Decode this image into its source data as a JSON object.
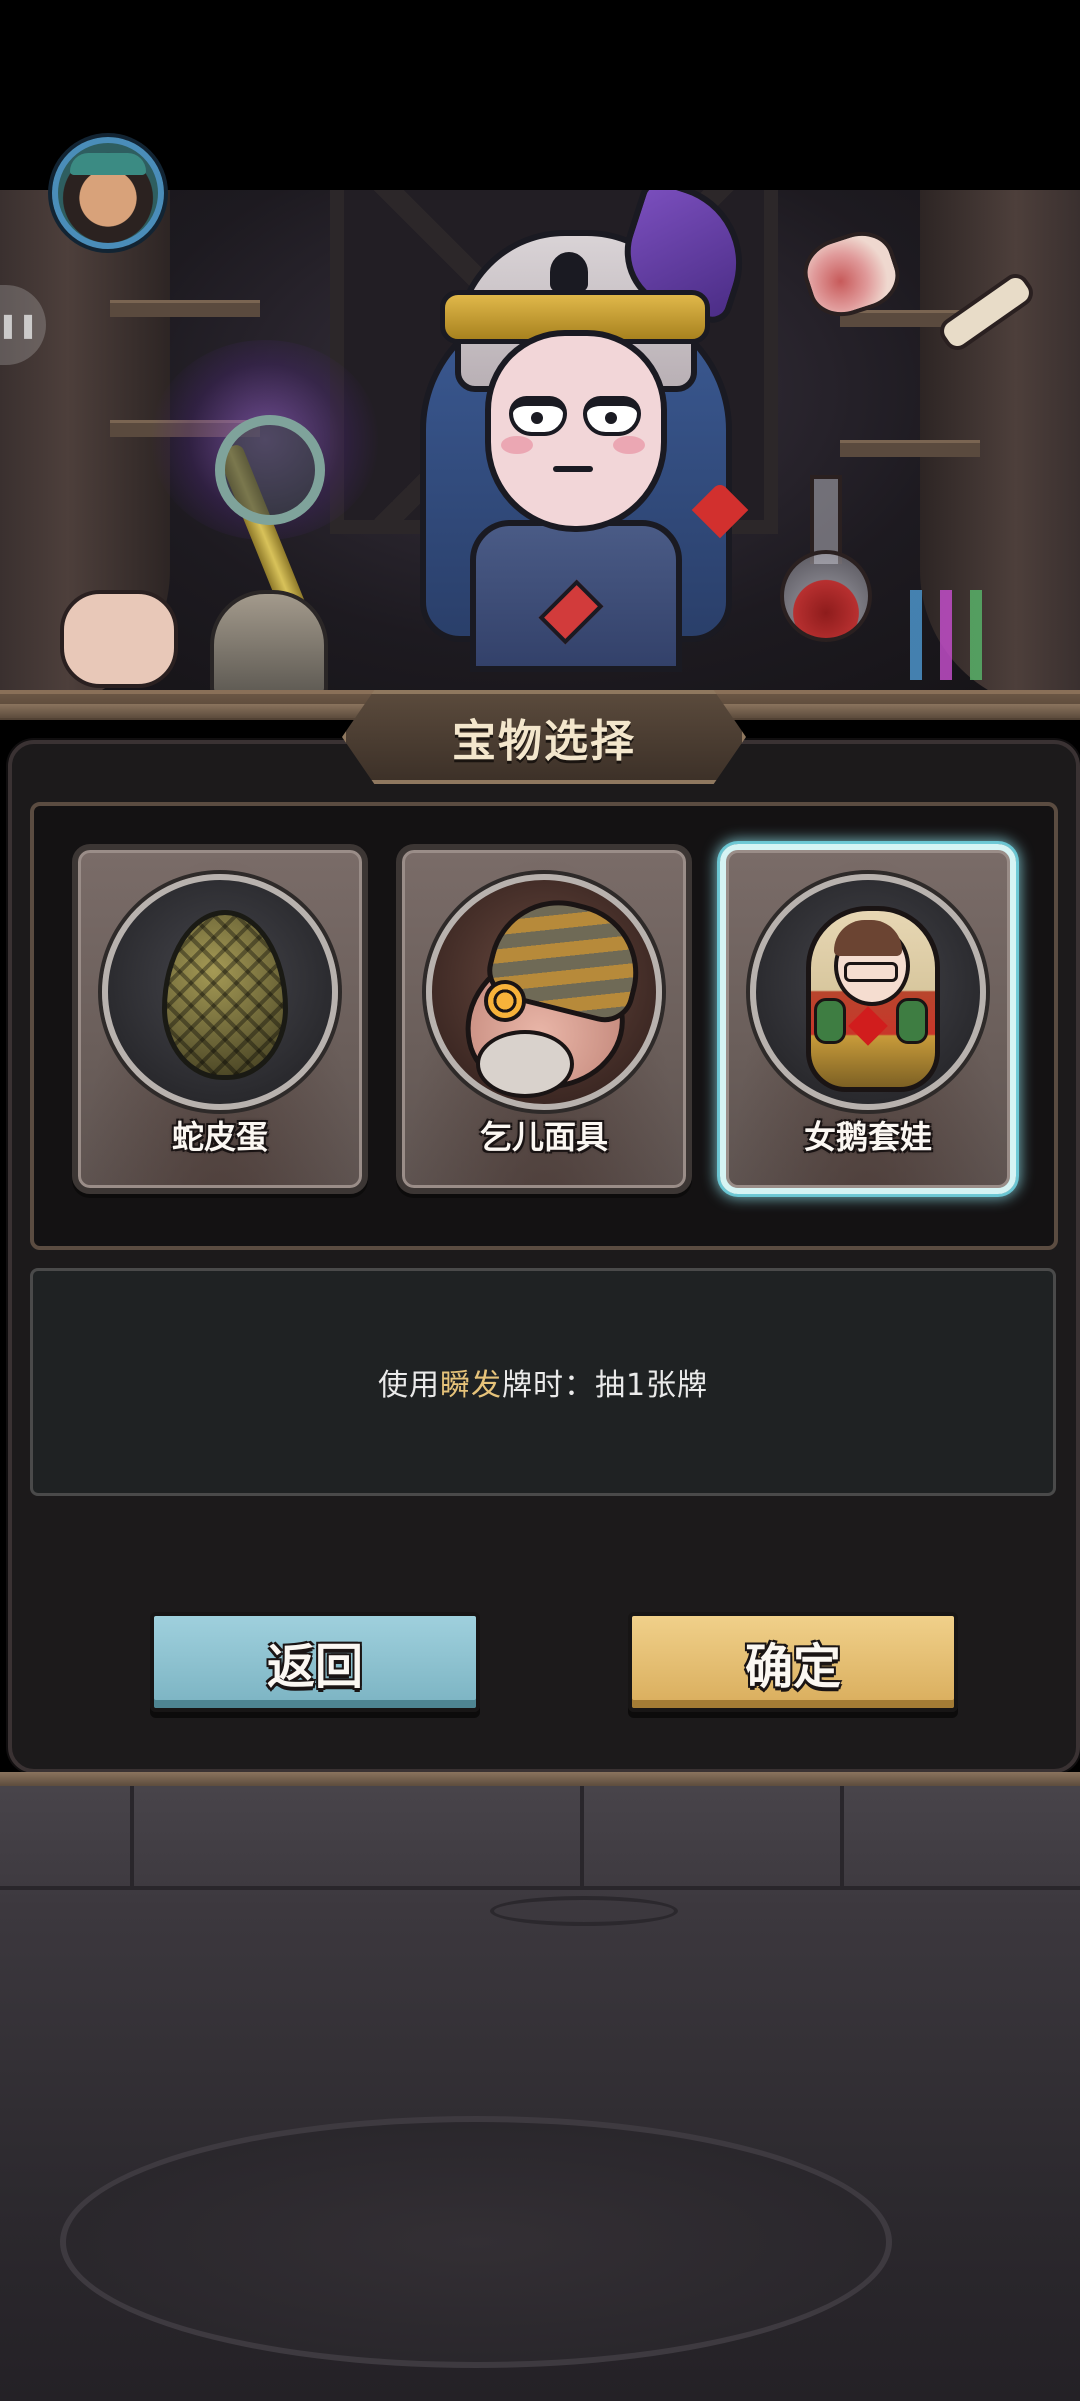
{
  "dialog": {
    "title": "宝物选择",
    "items": [
      {
        "name": "蛇皮蛋",
        "icon": "snakeskin-egg-icon",
        "selected": false
      },
      {
        "name": "乞儿面具",
        "icon": "beggar-mask-icon",
        "selected": false
      },
      {
        "name": "女鹅套娃",
        "icon": "matryoshka-doll-icon",
        "selected": true
      }
    ],
    "description": {
      "prefix": "使用",
      "highlight": "瞬发",
      "suffix": "牌时：抽1张牌",
      "highlight_color": "#e6c37a"
    },
    "buttons": {
      "back": "返回",
      "confirm": "确定"
    }
  },
  "colors": {
    "back_button": "#8fc3d0",
    "confirm_button": "#e6bf72",
    "selection_glow": "#8cdce6"
  }
}
